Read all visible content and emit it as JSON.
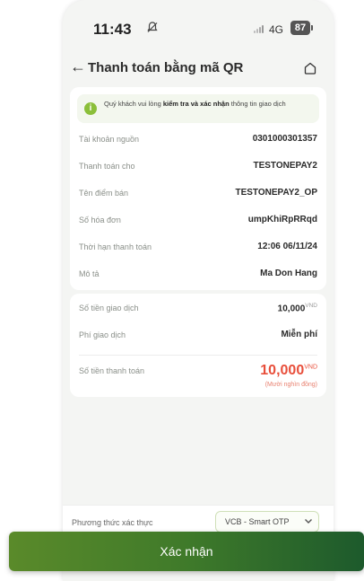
{
  "status_bar": {
    "time": "11:43",
    "network": "4G",
    "battery": "87"
  },
  "header": {
    "title": "Thanh toán bằng mã QR"
  },
  "notice": {
    "text_before": "Quý khách vui lòng ",
    "text_bold": "kiểm tra và xác nhận",
    "text_after": " thông tin giao dịch"
  },
  "details": [
    {
      "label": "Tài khoản nguồn",
      "value": "0301000301357"
    },
    {
      "label": "Thanh toán cho",
      "value": "TESTONEPAY2"
    },
    {
      "label": "Tên điểm bán",
      "value": "TESTONEPAY2_OP"
    },
    {
      "label": "Số hóa đơn",
      "value": "umpKhiRpRRqd"
    },
    {
      "label": "Thời hạn thanh toán",
      "value": "12:06 06/11/24"
    },
    {
      "label": "Mô tả",
      "value": "Ma Don Hang"
    }
  ],
  "fees": {
    "amount_label": "Số tiền giao dịch",
    "amount_value": "10,000",
    "currency": "VND",
    "fee_label": "Phí giao dịch",
    "fee_value": "Miễn phí",
    "total_label": "Số tiền thanh toán",
    "total_value": "10,000",
    "total_words": "(Mười nghìn đồng)"
  },
  "auth": {
    "label": "Phương thức xác thực",
    "selected": "VCB - Smart OTP"
  },
  "confirm_label": "Xác nhận",
  "colors": {
    "accent_green": "#4a7f2a",
    "total_red": "#e84e3a",
    "info_green": "#8bbf3a"
  }
}
